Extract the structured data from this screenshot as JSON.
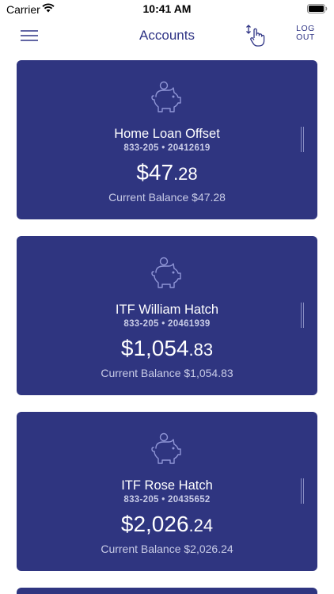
{
  "status_bar": {
    "carrier": "Carrier",
    "time": "10:41 AM"
  },
  "nav": {
    "title": "Accounts",
    "logout_line1": "LOG",
    "logout_line2": "OUT"
  },
  "colors": {
    "card_background": "#2f3580",
    "nav_accent": "#2f3485"
  },
  "accounts": [
    {
      "name": "Home Loan Offset",
      "number": "833-205 • 20412619",
      "amount_whole": "$47",
      "amount_cents": ".28",
      "balance_text": "Current Balance $47.28",
      "icon": "piggy-bank-icon"
    },
    {
      "name": "ITF William Hatch",
      "number": "833-205 • 20461939",
      "amount_whole": "$1,054",
      "amount_cents": ".83",
      "balance_text": "Current Balance $1,054.83",
      "icon": "piggy-bank-icon"
    },
    {
      "name": "ITF Rose Hatch",
      "number": "833-205 • 20435652",
      "amount_whole": "$2,026",
      "amount_cents": ".24",
      "balance_text": "Current Balance $2,026.24",
      "icon": "piggy-bank-icon"
    }
  ]
}
